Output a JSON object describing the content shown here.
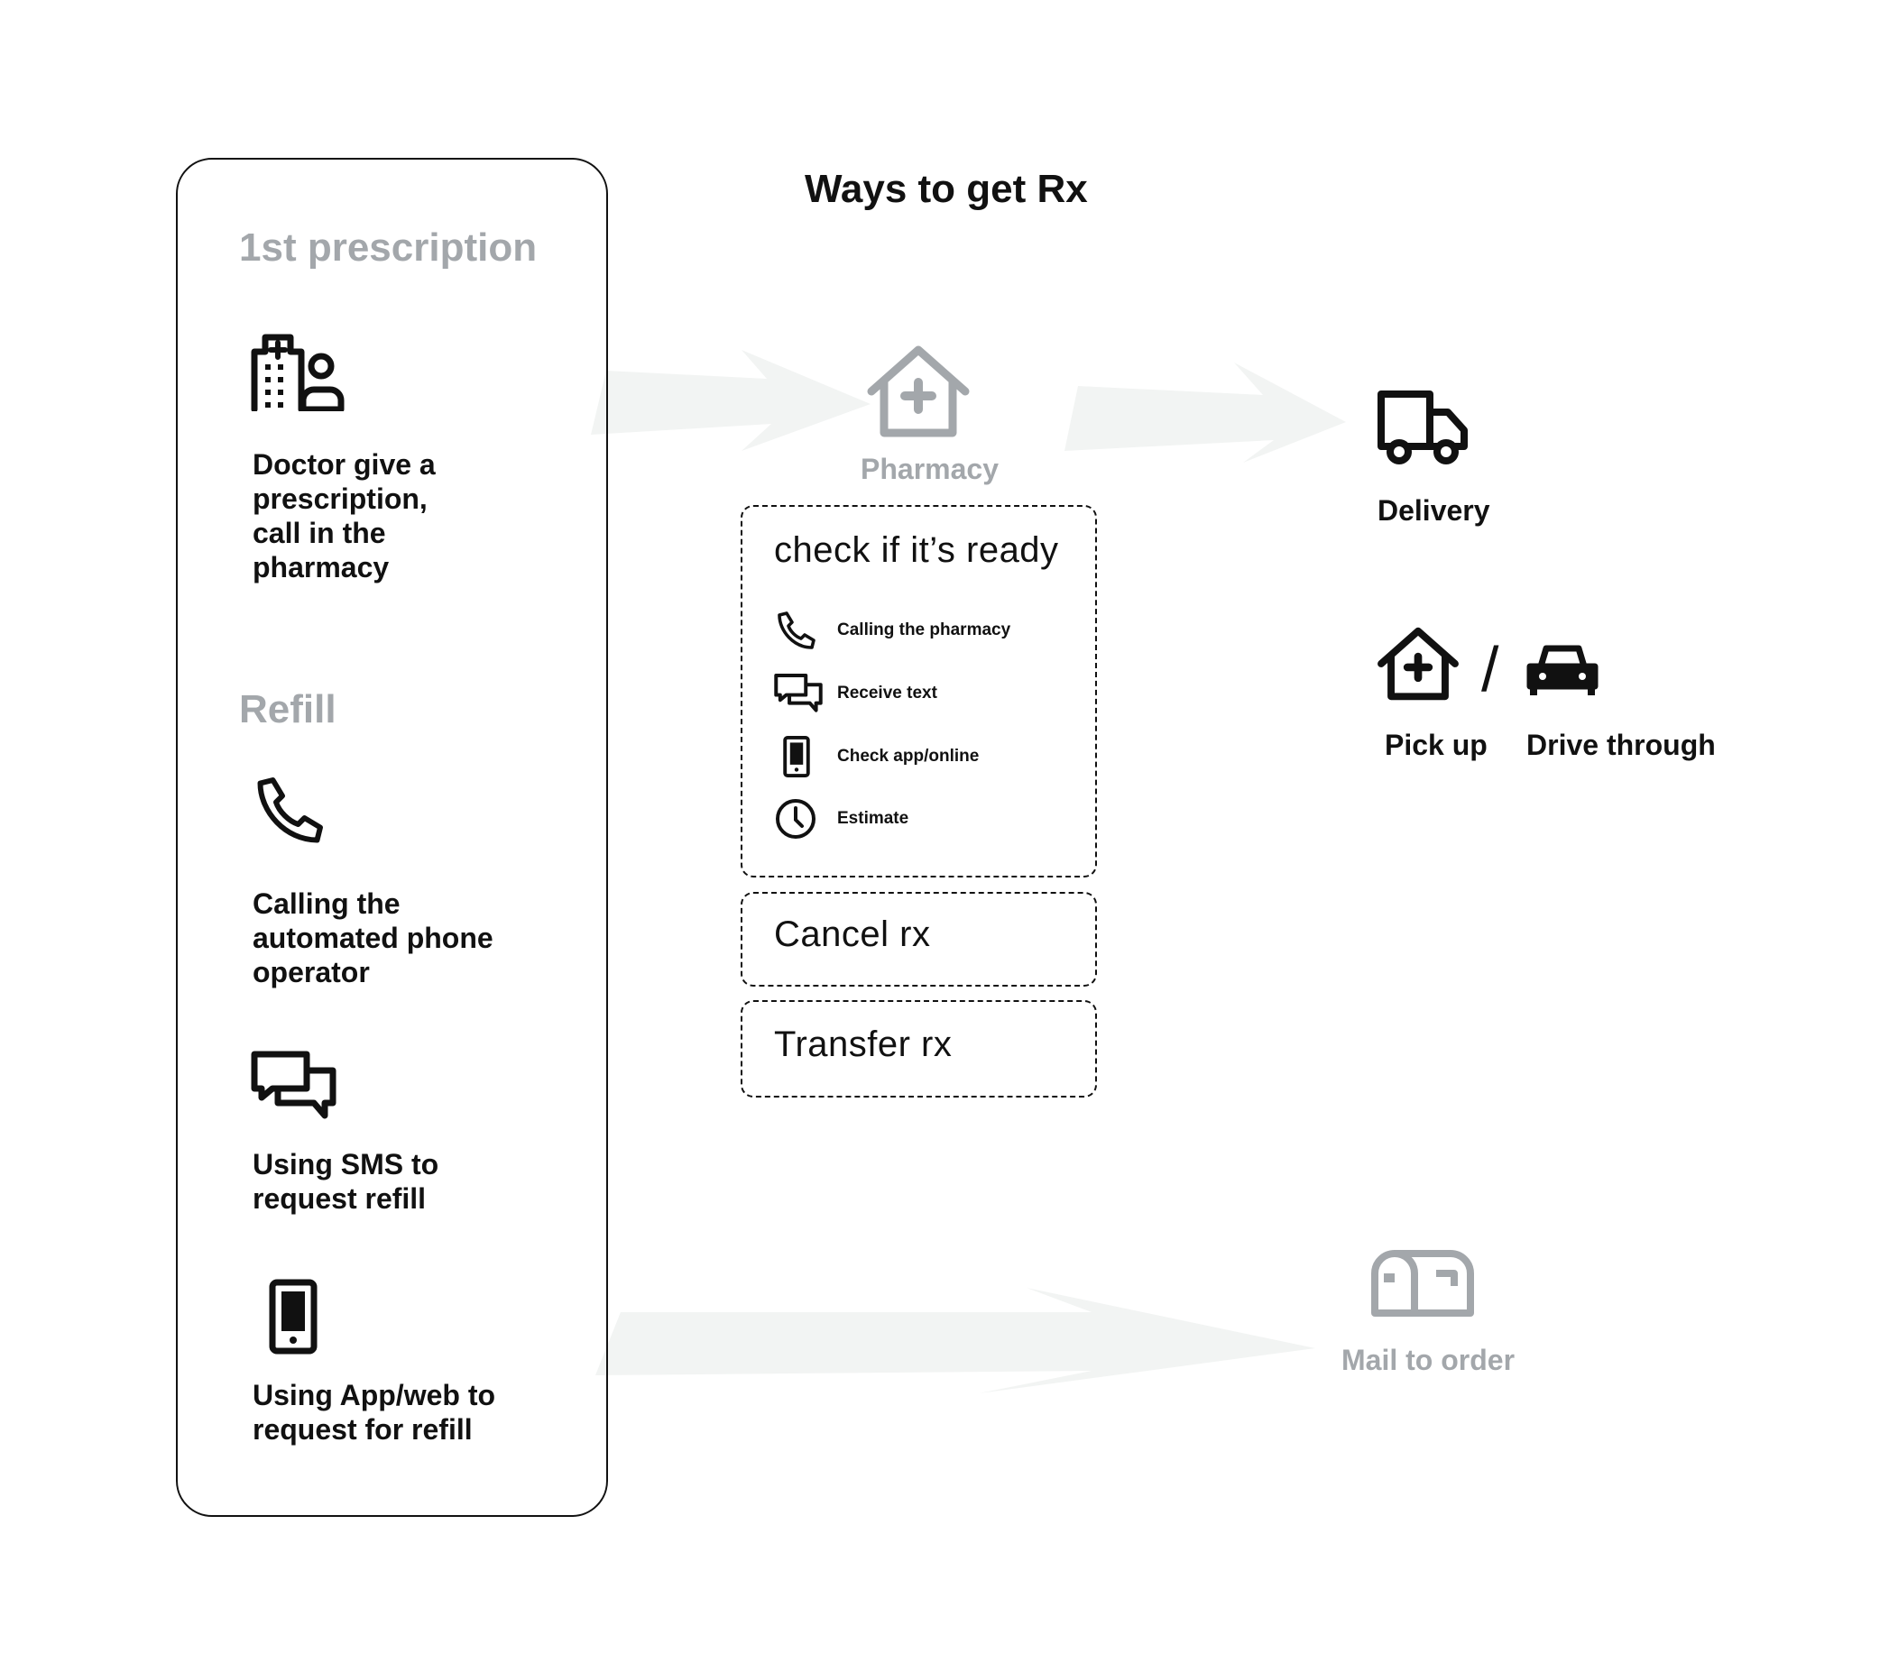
{
  "title": "Ways to get Rx",
  "left_panel": {
    "first_prescription": {
      "heading": "1st prescription",
      "icon": "hospital-doctor-icon",
      "text_lines": [
        "Doctor give a",
        "prescription,",
        "call in the",
        "pharmacy"
      ]
    },
    "refill": {
      "heading": "Refill",
      "items": [
        {
          "icon": "phone-icon",
          "text_lines": [
            "Calling the",
            "automated phone",
            "operator"
          ]
        },
        {
          "icon": "chat-icon",
          "text_lines": [
            "Using SMS to",
            "request refill"
          ]
        },
        {
          "icon": "smartphone-icon",
          "text_lines": [
            "Using App/web to",
            "request for refill"
          ]
        }
      ]
    }
  },
  "pharmacy": {
    "icon": "pharmacy-house-icon",
    "label": "Pharmacy",
    "check_box": {
      "title": "check if it’s ready",
      "rows": [
        {
          "icon": "phone-icon",
          "label": "Calling the pharmacy"
        },
        {
          "icon": "chat-icon",
          "label": "Receive text"
        },
        {
          "icon": "smartphone-icon",
          "label": "Check app/online"
        },
        {
          "icon": "clock-icon",
          "label": "Estimate"
        }
      ]
    },
    "cancel_box": {
      "title": "Cancel rx"
    },
    "transfer_box": {
      "title": "Transfer rx"
    }
  },
  "delivery": {
    "icon": "truck-icon",
    "label": "Delivery"
  },
  "pickup": {
    "icon": "pharmacy-house-icon",
    "label": "Pick up"
  },
  "separator": "/",
  "drive_through": {
    "icon": "car-icon",
    "label": "Drive through"
  },
  "mail": {
    "icon": "mailbox-icon",
    "label": "Mail to order"
  },
  "colors": {
    "text": "#111111",
    "muted": "#a3a7ab",
    "arrow": "#f2f4f3"
  }
}
